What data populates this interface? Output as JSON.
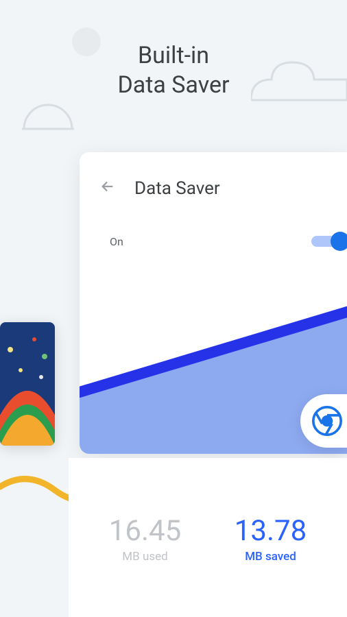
{
  "headline": {
    "line1": "Built-in",
    "line2": "Data Saver"
  },
  "card": {
    "title": "Data Saver",
    "toggle_label": "On",
    "toggle_state": "on"
  },
  "stats": {
    "used": {
      "value": "16.45",
      "label": "MB used"
    },
    "saved": {
      "value": "13.78",
      "label": "MB saved"
    }
  },
  "icons": {
    "back": "back-arrow",
    "chrome": "chrome-icon"
  }
}
